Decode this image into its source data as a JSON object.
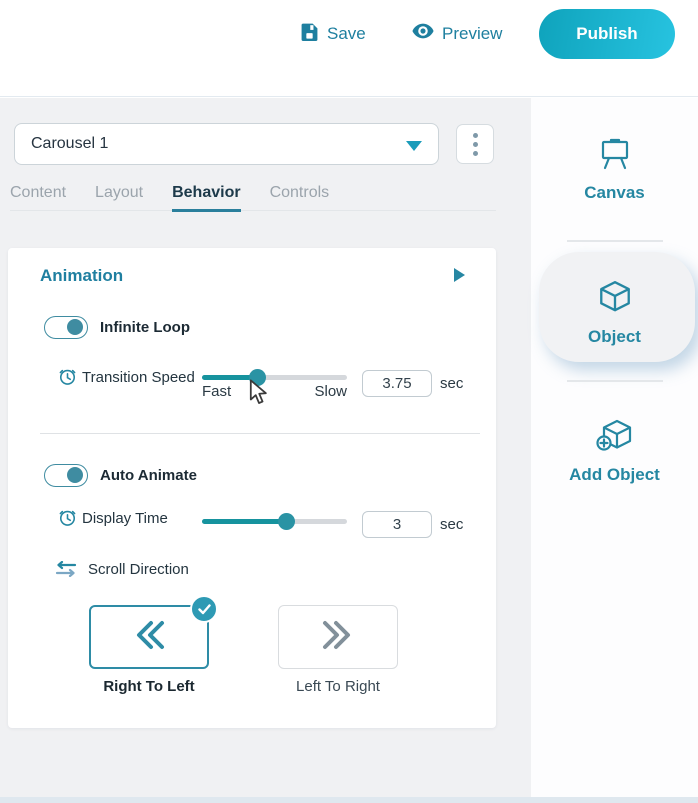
{
  "header": {
    "save_label": "Save",
    "preview_label": "Preview",
    "publish_label": "Publish"
  },
  "panel": {
    "object_selector": {
      "value": "Carousel 1"
    },
    "tabs": [
      {
        "label": "Content",
        "active": false
      },
      {
        "label": "Layout",
        "active": false
      },
      {
        "label": "Behavior",
        "active": true
      },
      {
        "label": "Controls",
        "active": false
      }
    ],
    "animation": {
      "title": "Animation",
      "infinite_loop": {
        "label": "Infinite Loop",
        "on": true
      },
      "transition_speed": {
        "label": "Transition Speed",
        "min_label": "Fast",
        "max_label": "Slow",
        "value": "3.75",
        "unit": "sec",
        "percent": 38.5
      },
      "auto_animate": {
        "label": "Auto Animate",
        "on": true
      },
      "display_time": {
        "label": "Display Time",
        "value": "3",
        "unit": "sec",
        "percent": 58.6
      },
      "scroll_direction": {
        "label": "Scroll Direction",
        "options": [
          {
            "label": "Right To Left",
            "selected": true
          },
          {
            "label": "Left To Right",
            "selected": false
          }
        ]
      }
    }
  },
  "sidebar": {
    "items": [
      {
        "label": "Canvas",
        "icon": "easel-icon",
        "selected": false
      },
      {
        "label": "Object",
        "icon": "cube-icon",
        "selected": true
      },
      {
        "label": "Add Object",
        "icon": "cube-plus-icon",
        "selected": false
      }
    ]
  },
  "colors": {
    "accent_teal": "#2587a2",
    "slider_fill": "#16939e",
    "publish_gradient_start": "#0fa3bc",
    "publish_gradient_end": "#27c3e0",
    "active_tab_text": "#1d3a4a",
    "inactive_tab_text": "#9ba4ac",
    "panel_bg": "#f0f1f3"
  }
}
